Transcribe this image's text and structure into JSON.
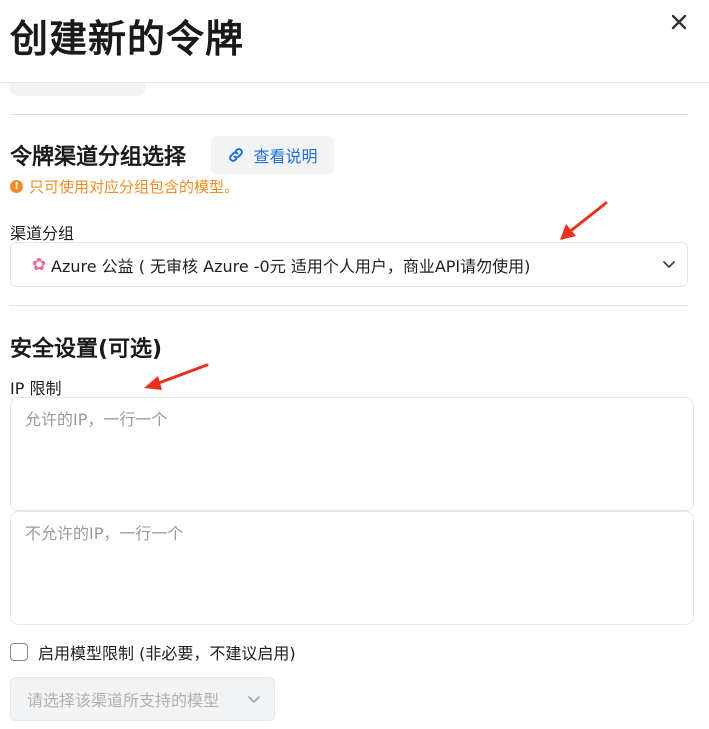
{
  "modal": {
    "title": "创建新的令牌",
    "close_icon": "close-icon"
  },
  "group_section": {
    "title": "令牌渠道分组选择",
    "help_link_label": "查看说明",
    "help_link_icon": "link-icon",
    "note": "只可使用对应分组包含的模型。",
    "note_icon": "info-icon",
    "field_label": "渠道分组",
    "selected_value": "Azure 公益 ( 无审核 Azure -0元 适用个人用户，商业API请勿使用)",
    "selected_icon": "cherry-blossom-icon",
    "chevron_icon": "chevron-down-icon"
  },
  "security_section": {
    "title": "安全设置(可选)",
    "ip_label": "IP 限制",
    "allowed_ip_placeholder": "允许的IP，一行一个",
    "denied_ip_placeholder": "不允许的IP，一行一个",
    "model_limit_label": "启用模型限制 (非必要，不建议启用)",
    "model_limit_checked": false,
    "model_select_placeholder": "请选择该渠道所支持的模型",
    "model_select_chevron": "chevron-down-icon"
  },
  "colors": {
    "accent_link": "#1e6fd9",
    "warning": "#f28c28",
    "annotation_arrow": "#e8321e"
  }
}
